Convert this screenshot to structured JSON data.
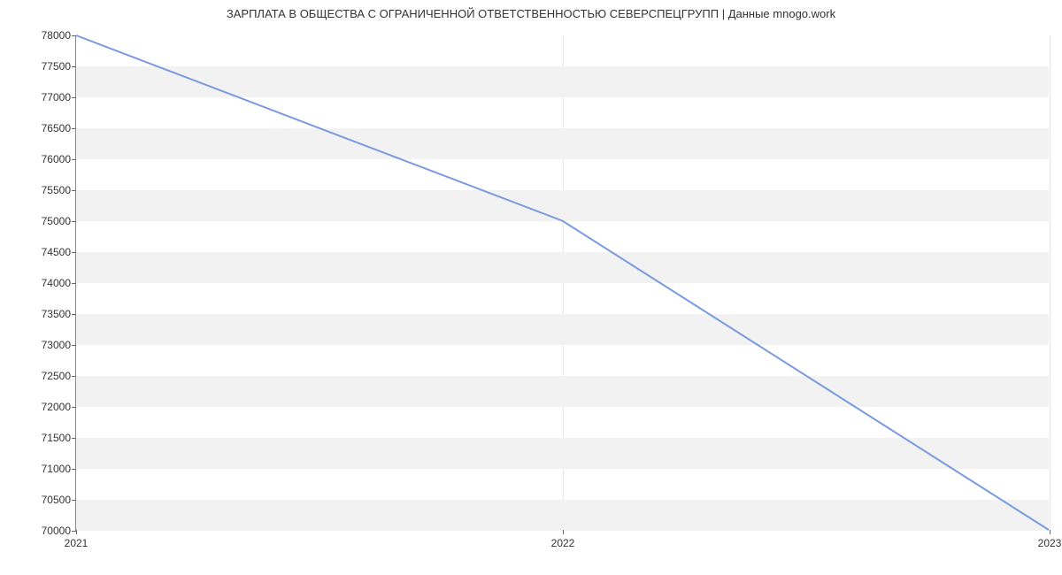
{
  "chart_data": {
    "type": "line",
    "title": "ЗАРПЛАТА В  ОБЩЕСТВА С ОГРАНИЧЕННОЙ ОТВЕТСТВЕННОСТЬЮ СЕВЕРСПЕЦГРУПП | Данные mnogo.work",
    "xlabel": "",
    "ylabel": "",
    "x": [
      2021,
      2022,
      2023
    ],
    "values": [
      78000,
      75000,
      70000
    ],
    "x_ticks": [
      2021,
      2022,
      2023
    ],
    "y_ticks": [
      70000,
      70500,
      71000,
      71500,
      72000,
      72500,
      73000,
      73500,
      74000,
      74500,
      75000,
      75500,
      76000,
      76500,
      77000,
      77500,
      78000
    ],
    "xlim": [
      2021,
      2023
    ],
    "ylim": [
      70000,
      78000
    ],
    "grid_bands": true,
    "line_color": "#7a9ae0"
  }
}
